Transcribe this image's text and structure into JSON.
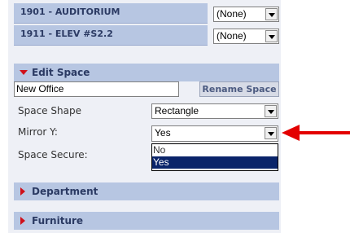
{
  "rooms": [
    {
      "name": "1901 - AUDITORIUM",
      "department": "(None)"
    },
    {
      "name": "1911 - ELEV #S2.2",
      "department": "(None)"
    }
  ],
  "edit_space": {
    "title": "Edit Space",
    "name_value": "New Office",
    "rename_button": "Rename Space",
    "shape_label": "Space Shape",
    "shape_value": "Rectangle",
    "mirror_label": "Mirror Y:",
    "mirror_value": "Yes",
    "secure_label": "Space Secure:",
    "mirror_options": [
      "No",
      "Yes"
    ]
  },
  "sections": {
    "department": "Department",
    "furniture": "Furniture"
  },
  "colors": {
    "header_bg": "#b7c6e2",
    "panel_bg": "#eef0f6",
    "accent_red": "#d0101a",
    "selected_option": "#0a246a"
  }
}
